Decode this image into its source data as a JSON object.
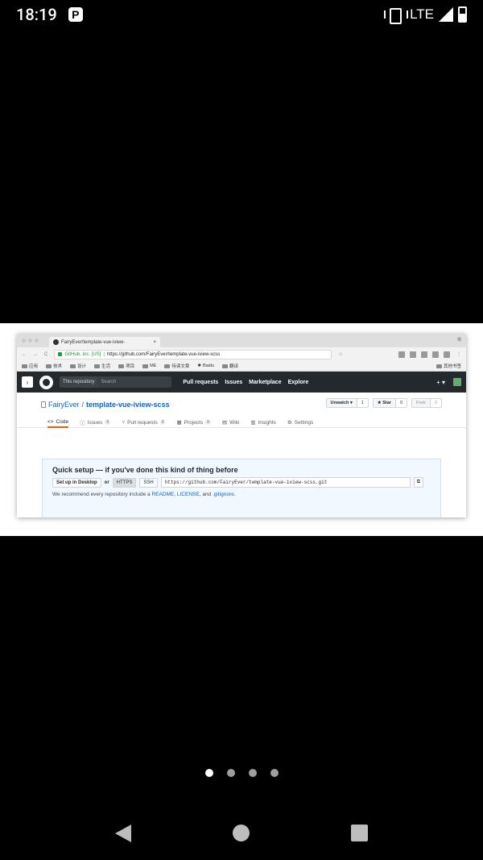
{
  "status_bar": {
    "time": "18:19",
    "app_badge": "P",
    "network": "LTE"
  },
  "browser": {
    "tab_title": "FairyEver/template-vue-iview-",
    "tab_close": "×",
    "tab_user": "杨",
    "secure_label": "GitHub, Inc. [US]",
    "url": "https://github.com/FairyEver/template-vue-iview-scss",
    "bookmarks": [
      "应用",
      "技术",
      "设计",
      "生活",
      "项目",
      "ME",
      "待读文章",
      "Baidu",
      "翻译"
    ],
    "bookmarks_other": "其他书签"
  },
  "github": {
    "scope_label": "This repository",
    "search_placeholder": "Search",
    "nav": [
      "Pull requests",
      "Issues",
      "Marketplace",
      "Explore"
    ],
    "plus": "+ ▾",
    "repo_owner": "FairyEver",
    "repo_sep": "/",
    "repo_name": "template-vue-iview-scss",
    "watch": {
      "label": "Unwatch ▾",
      "count": "1"
    },
    "star": {
      "label": "★ Star",
      "count": "0"
    },
    "fork": {
      "label": "Fork",
      "count": "0"
    },
    "tabs": [
      {
        "label": "Code",
        "count": ""
      },
      {
        "label": "Issues",
        "count": "0"
      },
      {
        "label": "Pull requests",
        "count": "0"
      },
      {
        "label": "Projects",
        "count": "0"
      },
      {
        "label": "Wiki",
        "count": ""
      },
      {
        "label": "Insights",
        "count": ""
      },
      {
        "label": "Settings",
        "count": ""
      }
    ],
    "quick_setup": {
      "title": "Quick setup — if you've done this kind of thing before",
      "desktop_button": "Set up in Desktop",
      "or": "or",
      "https": "HTTPS",
      "ssh": "SSH",
      "clone_url": "https://github.com/FairyEver/template-vue-iview-scss.git",
      "recommend_prefix": "We recommend every repository include a",
      "readme": "README",
      "license": "LICENSE",
      "and": ", and",
      "gitignore": ".gitignore",
      "period": "."
    }
  },
  "pagination": {
    "total": 4,
    "active": 0
  }
}
